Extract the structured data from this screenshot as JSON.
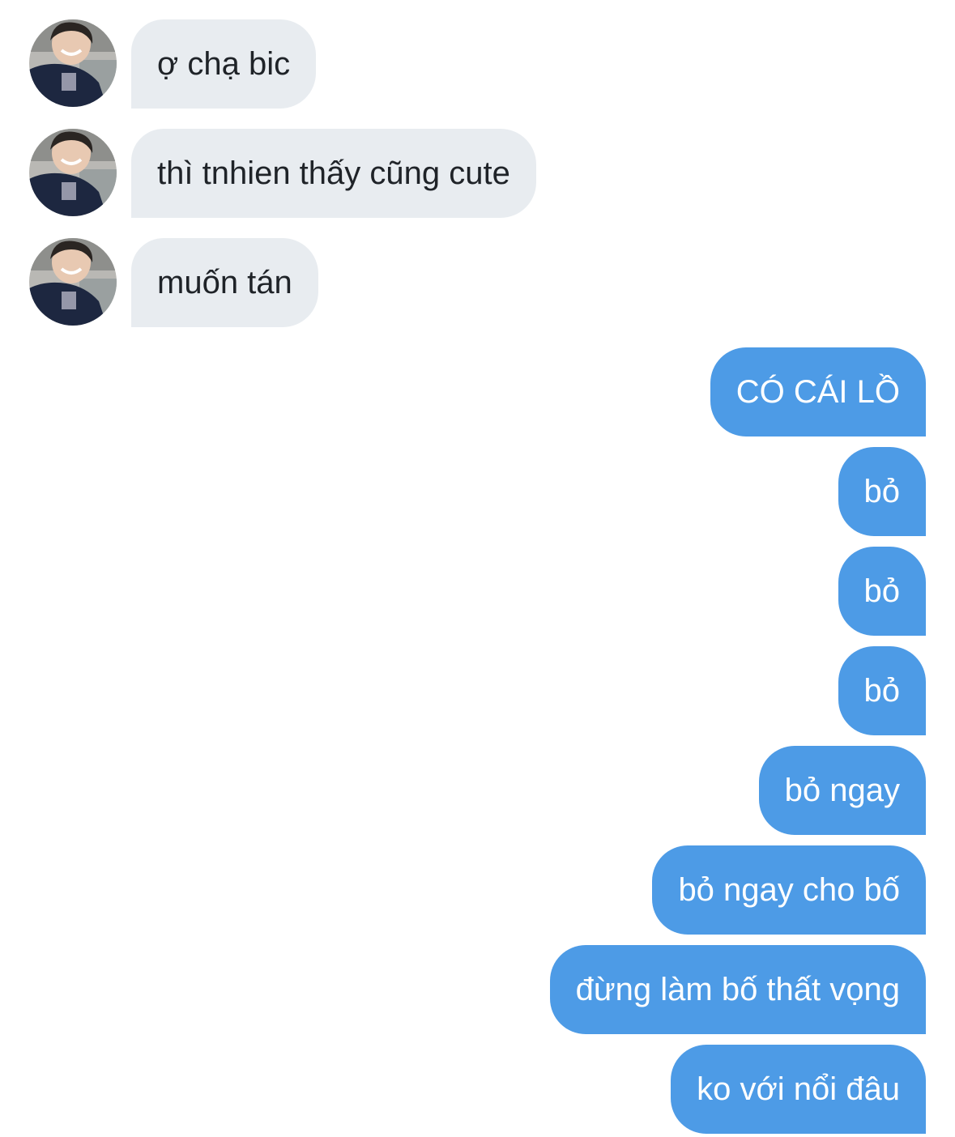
{
  "conversation": {
    "incoming_avatar": "contact-avatar",
    "colors": {
      "incoming_bubble": "#e8ecf0",
      "incoming_text": "#1f2328",
      "outgoing_bubble": "#4d9be6",
      "outgoing_text": "#ffffff"
    },
    "messages": [
      {
        "direction": "incoming",
        "text": "ợ chạ bic"
      },
      {
        "direction": "incoming",
        "text": "thì tnhien thấy cũng cute"
      },
      {
        "direction": "incoming",
        "text": "muốn tán"
      },
      {
        "direction": "outgoing",
        "text": "CÓ CÁI LỒ"
      },
      {
        "direction": "outgoing",
        "text": "bỏ"
      },
      {
        "direction": "outgoing",
        "text": "bỏ"
      },
      {
        "direction": "outgoing",
        "text": "bỏ"
      },
      {
        "direction": "outgoing",
        "text": "bỏ ngay"
      },
      {
        "direction": "outgoing",
        "text": "bỏ ngay cho bố"
      },
      {
        "direction": "outgoing",
        "text": "đừng làm bố thất vọng"
      },
      {
        "direction": "outgoing",
        "text": "ko với nổi đâu"
      }
    ]
  }
}
